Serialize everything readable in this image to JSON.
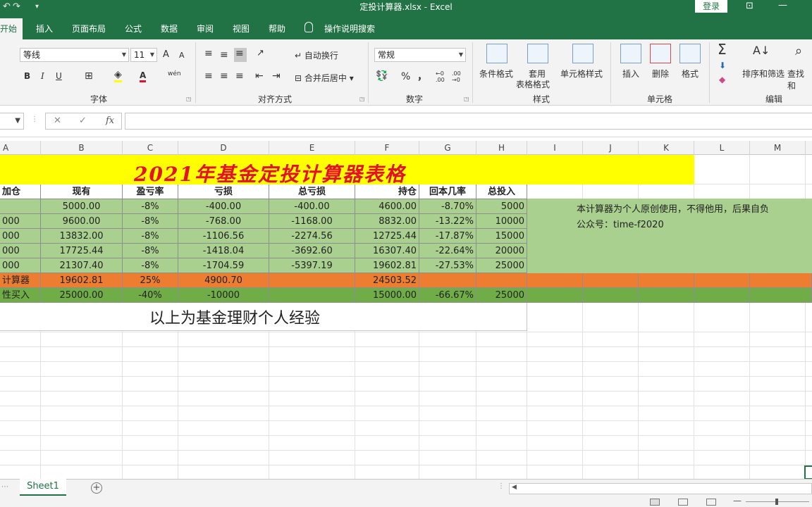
{
  "titlebar": {
    "title": "定投计算器.xlsx  -  Excel",
    "login": "登录",
    "undo_icon": "undo-icon",
    "redo_icon": "redo-icon",
    "customize_icon": "customize-qat-icon"
  },
  "tabs": [
    "开始",
    "插入",
    "页面布局",
    "公式",
    "数据",
    "审阅",
    "视图",
    "帮助",
    "操作说明搜索"
  ],
  "ribbon": {
    "font_name": "等线",
    "font_size": "11",
    "grow_font": "A",
    "shrink_font": "A",
    "bold": "B",
    "italic": "I",
    "underline": "U",
    "wen": "wén",
    "font_group": "字体",
    "wrap_text": "自动换行",
    "merge_center": "合并后居中",
    "align_group": "对齐方式",
    "number_format": "常规",
    "percent": "%",
    "comma": "，",
    "dec_inc": "←0 .00",
    "dec_dec": ".00 →0",
    "number_group": "数字",
    "conditional_format": "条件格式",
    "table_format_1": "套用",
    "table_format_2": "表格格式",
    "cell_style": "单元格样式",
    "style_group": "样式",
    "insert": "插入",
    "delete": "删除",
    "format": "格式",
    "cells_group": "单元格",
    "sort_filter": "排序和筛选",
    "find_select": "查找和",
    "edit_group": "编辑",
    "sigma": "Σ"
  },
  "formula_bar": {
    "cancel": "✕",
    "enter": "✓",
    "fx": "fx",
    "content": ""
  },
  "columns": [
    "A",
    "B",
    "C",
    "D",
    "E",
    "F",
    "G",
    "H",
    "I",
    "J",
    "K",
    "L",
    "M"
  ],
  "sheet": {
    "title": "2021年基金定投计算器表格",
    "headers": [
      "加仓",
      "现有",
      "盈亏率",
      "亏损",
      "总亏损",
      "持仓",
      "回本几率",
      "总投入"
    ],
    "rows": [
      [
        "",
        "5000.00",
        "-8%",
        "-400.00",
        "-400.00",
        "4600.00",
        "-8.70%",
        "5000"
      ],
      [
        "000",
        "9600.00",
        "-8%",
        "-768.00",
        "-1168.00",
        "8832.00",
        "-13.22%",
        "10000"
      ],
      [
        "000",
        "13832.00",
        "-8%",
        "-1106.56",
        "-2274.56",
        "12725.44",
        "-17.87%",
        "15000"
      ],
      [
        "000",
        "17725.44",
        "-8%",
        "-1418.04",
        "-3692.60",
        "16307.40",
        "-22.64%",
        "20000"
      ],
      [
        "000",
        "21307.40",
        "-8%",
        "-1704.59",
        "-5397.19",
        "19602.81",
        "-27.53%",
        "25000"
      ]
    ],
    "orange_row": [
      "计算器",
      "19602.81",
      "25%",
      "4900.70",
      "",
      "24503.52",
      "",
      ""
    ],
    "green_row": [
      "性买入",
      "25000.00",
      "-40%",
      "-10000",
      "",
      "15000.00",
      "-66.67%",
      "25000"
    ],
    "note_line1": "本计算器为个人原创使用，不得他用，后果自负",
    "note_line2": "公众号：time-f2020",
    "experience": "以上为基金理财个人经验"
  },
  "sheet_tabs": {
    "active": "Sheet1",
    "add": "+"
  },
  "colors": {
    "excel_green": "#217346",
    "light_green": "#a9d08e",
    "orange": "#ed7d31",
    "dark_green": "#70ad47",
    "yellow": "#ffff00",
    "title_red": "#e4112a"
  }
}
